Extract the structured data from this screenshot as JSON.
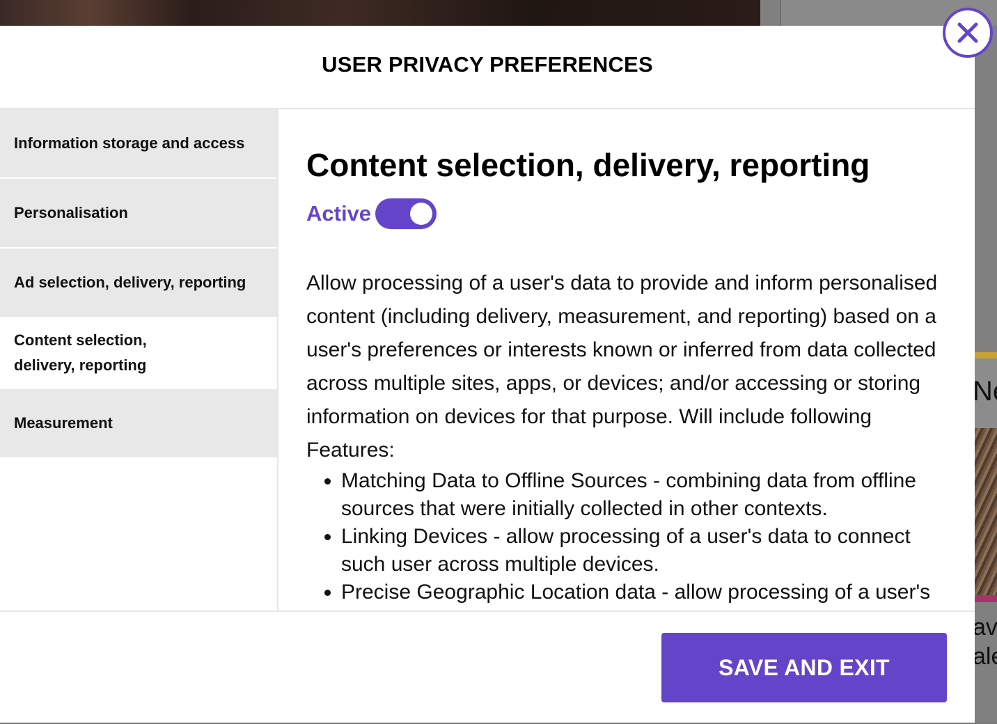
{
  "background": {
    "card_text": "Ne",
    "teaser_lines": [
      "av",
      "ale"
    ]
  },
  "modal": {
    "title": "USER PRIVACY PREFERENCES",
    "close_icon": "close-icon",
    "nav": {
      "items": [
        {
          "label": "Information storage and access",
          "active": false
        },
        {
          "label": "Personalisation",
          "active": false
        },
        {
          "label": "Ad selection, delivery, reporting",
          "active": false
        },
        {
          "label": "Content selection, delivery, reporting",
          "active": true
        },
        {
          "label": "Measurement",
          "active": false
        }
      ]
    },
    "content": {
      "title": "Content selection, delivery, reporting",
      "status_label": "Active",
      "toggle_on": true,
      "description": "Allow processing of a user's data to provide and inform personalised content (including delivery, measurement, and reporting) based on a user's preferences or interests known or inferred from data collected across multiple sites, apps, or devices; and/or accessing or storing information on devices for that purpose. Will include following Features:",
      "features": [
        "Matching Data to Offline Sources - combining data from offline sources that were initially collected in other contexts.",
        "Linking Devices - allow processing of a user's data to connect such user across multiple devices.",
        "Precise Geographic Location data - allow processing of a user's precise geographic location data in support of a"
      ]
    },
    "footer": {
      "save_label": "SAVE AND EXIT"
    },
    "colors": {
      "accent": "#6445c9",
      "nav_bg": "#e8e8e8"
    }
  }
}
